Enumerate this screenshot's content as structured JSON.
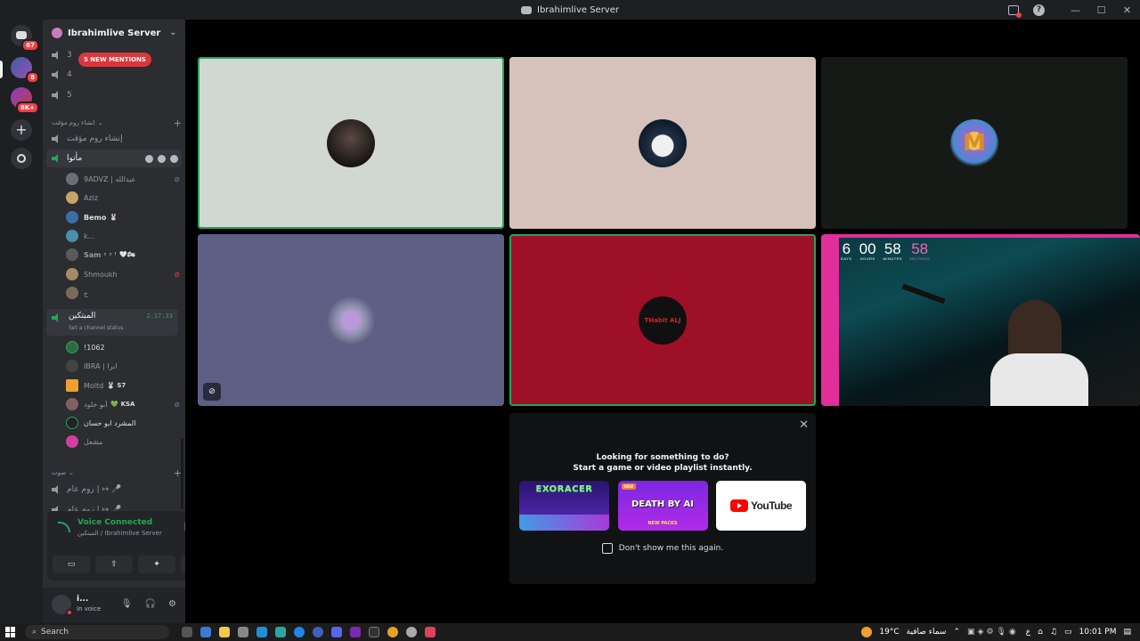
{
  "window": {
    "title": "Ibrahimlive Server"
  },
  "rail": {
    "items": [
      {
        "name": "home",
        "badge": "67"
      },
      {
        "name": "ibrahimlive",
        "badge": "8"
      },
      {
        "name": "server-2",
        "badge": "8K+"
      }
    ]
  },
  "sidebar": {
    "server_name": "Ibrahimlive Server",
    "mentions_pill": "5 NEW MENTIONS",
    "top_channels": [
      "3",
      "4",
      "5"
    ],
    "category_temp": "انشاء روم مؤقت",
    "temp_channel": "إنشاء روم مؤقت",
    "active_voice_channel": {
      "name": "مأتوا",
      "users": [
        {
          "name": "9ADVZ | عبدالله",
          "color": "#6b6f76"
        },
        {
          "name": "Aziz",
          "color": "#c9a36a"
        },
        {
          "name": "Bemo",
          "color": "#3a6ea5",
          "badge": "🐰"
        },
        {
          "name": "k...",
          "color": "#4b8fa8"
        },
        {
          "name": "Sam ᶻ ᶻ ˡ",
          "color": "#5a5a5a",
          "badge": "🤍🏍"
        },
        {
          "name": "Shmoukh",
          "color": "#a68a64"
        },
        {
          "name": "خ",
          "color": "#7a6a5a"
        }
      ]
    },
    "connected_channel": {
      "name": "المبتكين",
      "timer": "2:17:33",
      "status_placeholder": "Set a channel status",
      "users": [
        {
          "name": "!1062",
          "color": "#2e6b3f"
        },
        {
          "name": "IBRA | ابرا",
          "color": "#444"
        },
        {
          "name": "Moltd ",
          "color": "#f0a030",
          "badge": "🐰 S7"
        },
        {
          "name": "أبو خلود",
          "color": "#806060",
          "badge": "💚 KSA"
        },
        {
          "name": "المشرد ابو حسان",
          "color": "#222"
        },
        {
          "name": "مشعل",
          "color": "#d23fa0"
        }
      ]
    },
    "category_voice": "صوت",
    "voice_rooms": [
      "زوم عام | ↦ 🎤",
      "زوم عام | ↦ 🎤"
    ]
  },
  "voice_panel": {
    "status": "Voice Connected",
    "location": "المبتكين / Ibrahimlive Server"
  },
  "user_panel": {
    "name": "i...",
    "status": "In voice"
  },
  "stream": {
    "countdown": [
      {
        "value": "6",
        "label": "DAYS"
      },
      {
        "value": "00",
        "label": "HOURS"
      },
      {
        "value": "58",
        "label": "MINUTES"
      },
      {
        "value": "58",
        "label": "SECONDS"
      }
    ]
  },
  "activity": {
    "title_line1": "Looking for something to do?",
    "title_line2": "Start a game or video playlist instantly.",
    "cards": [
      "EXORACER",
      "DEATH BY AI",
      "YouTube"
    ],
    "card_tag": "NEW PACKS",
    "checkbox_label": "Don't show me this again."
  },
  "tile_labels": {
    "thabit": "THabit ALJ"
  },
  "taskbar": {
    "search_placeholder": "Search",
    "weather": "19°C",
    "weather_desc": "سماء صافية",
    "lang": "ع",
    "time": "10:01 PM"
  }
}
